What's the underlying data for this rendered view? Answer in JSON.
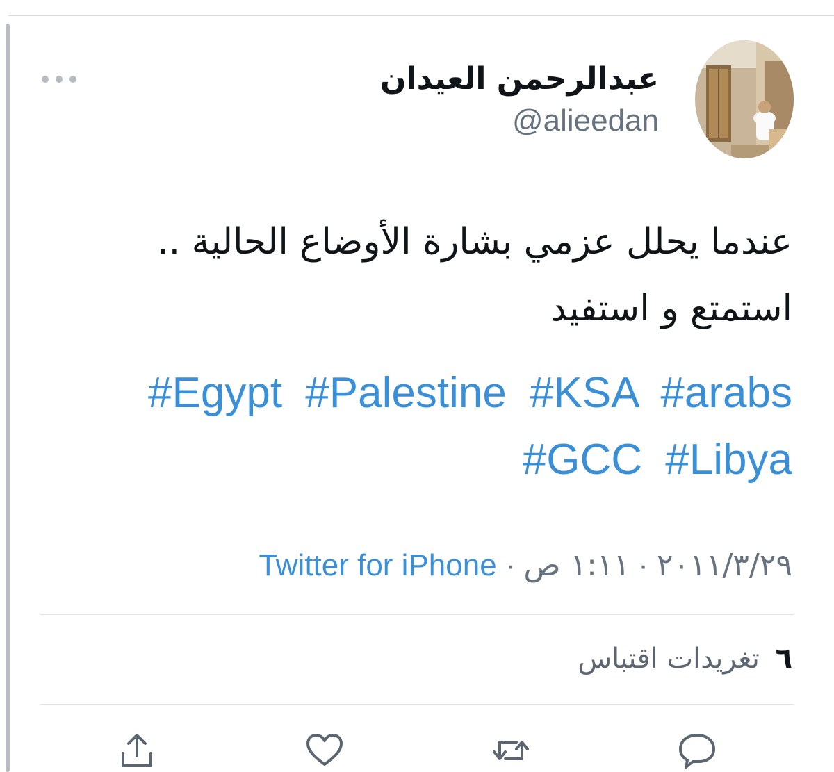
{
  "user": {
    "display_name": "عبدالرحمن العيدان",
    "handle": "@alieedan"
  },
  "tweet": {
    "lines": [
      "عندما يحلل عزمي بشارة الأوضاع الحالية ..",
      "استمتع و استفيد"
    ],
    "hashtags_line1": [
      "#Egypt",
      "#Palestine",
      "#KSA",
      "#arabs"
    ],
    "hashtags_line2": [
      "#GCC",
      "#Libya"
    ]
  },
  "meta": {
    "date": "٢٠١١/٣/٢٩",
    "time": "١:١١ ص",
    "separator": "·",
    "source": "Twitter for iPhone"
  },
  "stats": {
    "quote_count": "٦",
    "quote_label": "تغريدات اقتباس"
  },
  "actions": {
    "reply_icon": "reply-icon",
    "retweet_icon": "retweet-icon",
    "like_icon": "heart-icon",
    "share_icon": "share-icon"
  },
  "colors": {
    "link": "#3a90d8",
    "secondary_text": "#66737f",
    "primary_text": "#0f1419"
  }
}
